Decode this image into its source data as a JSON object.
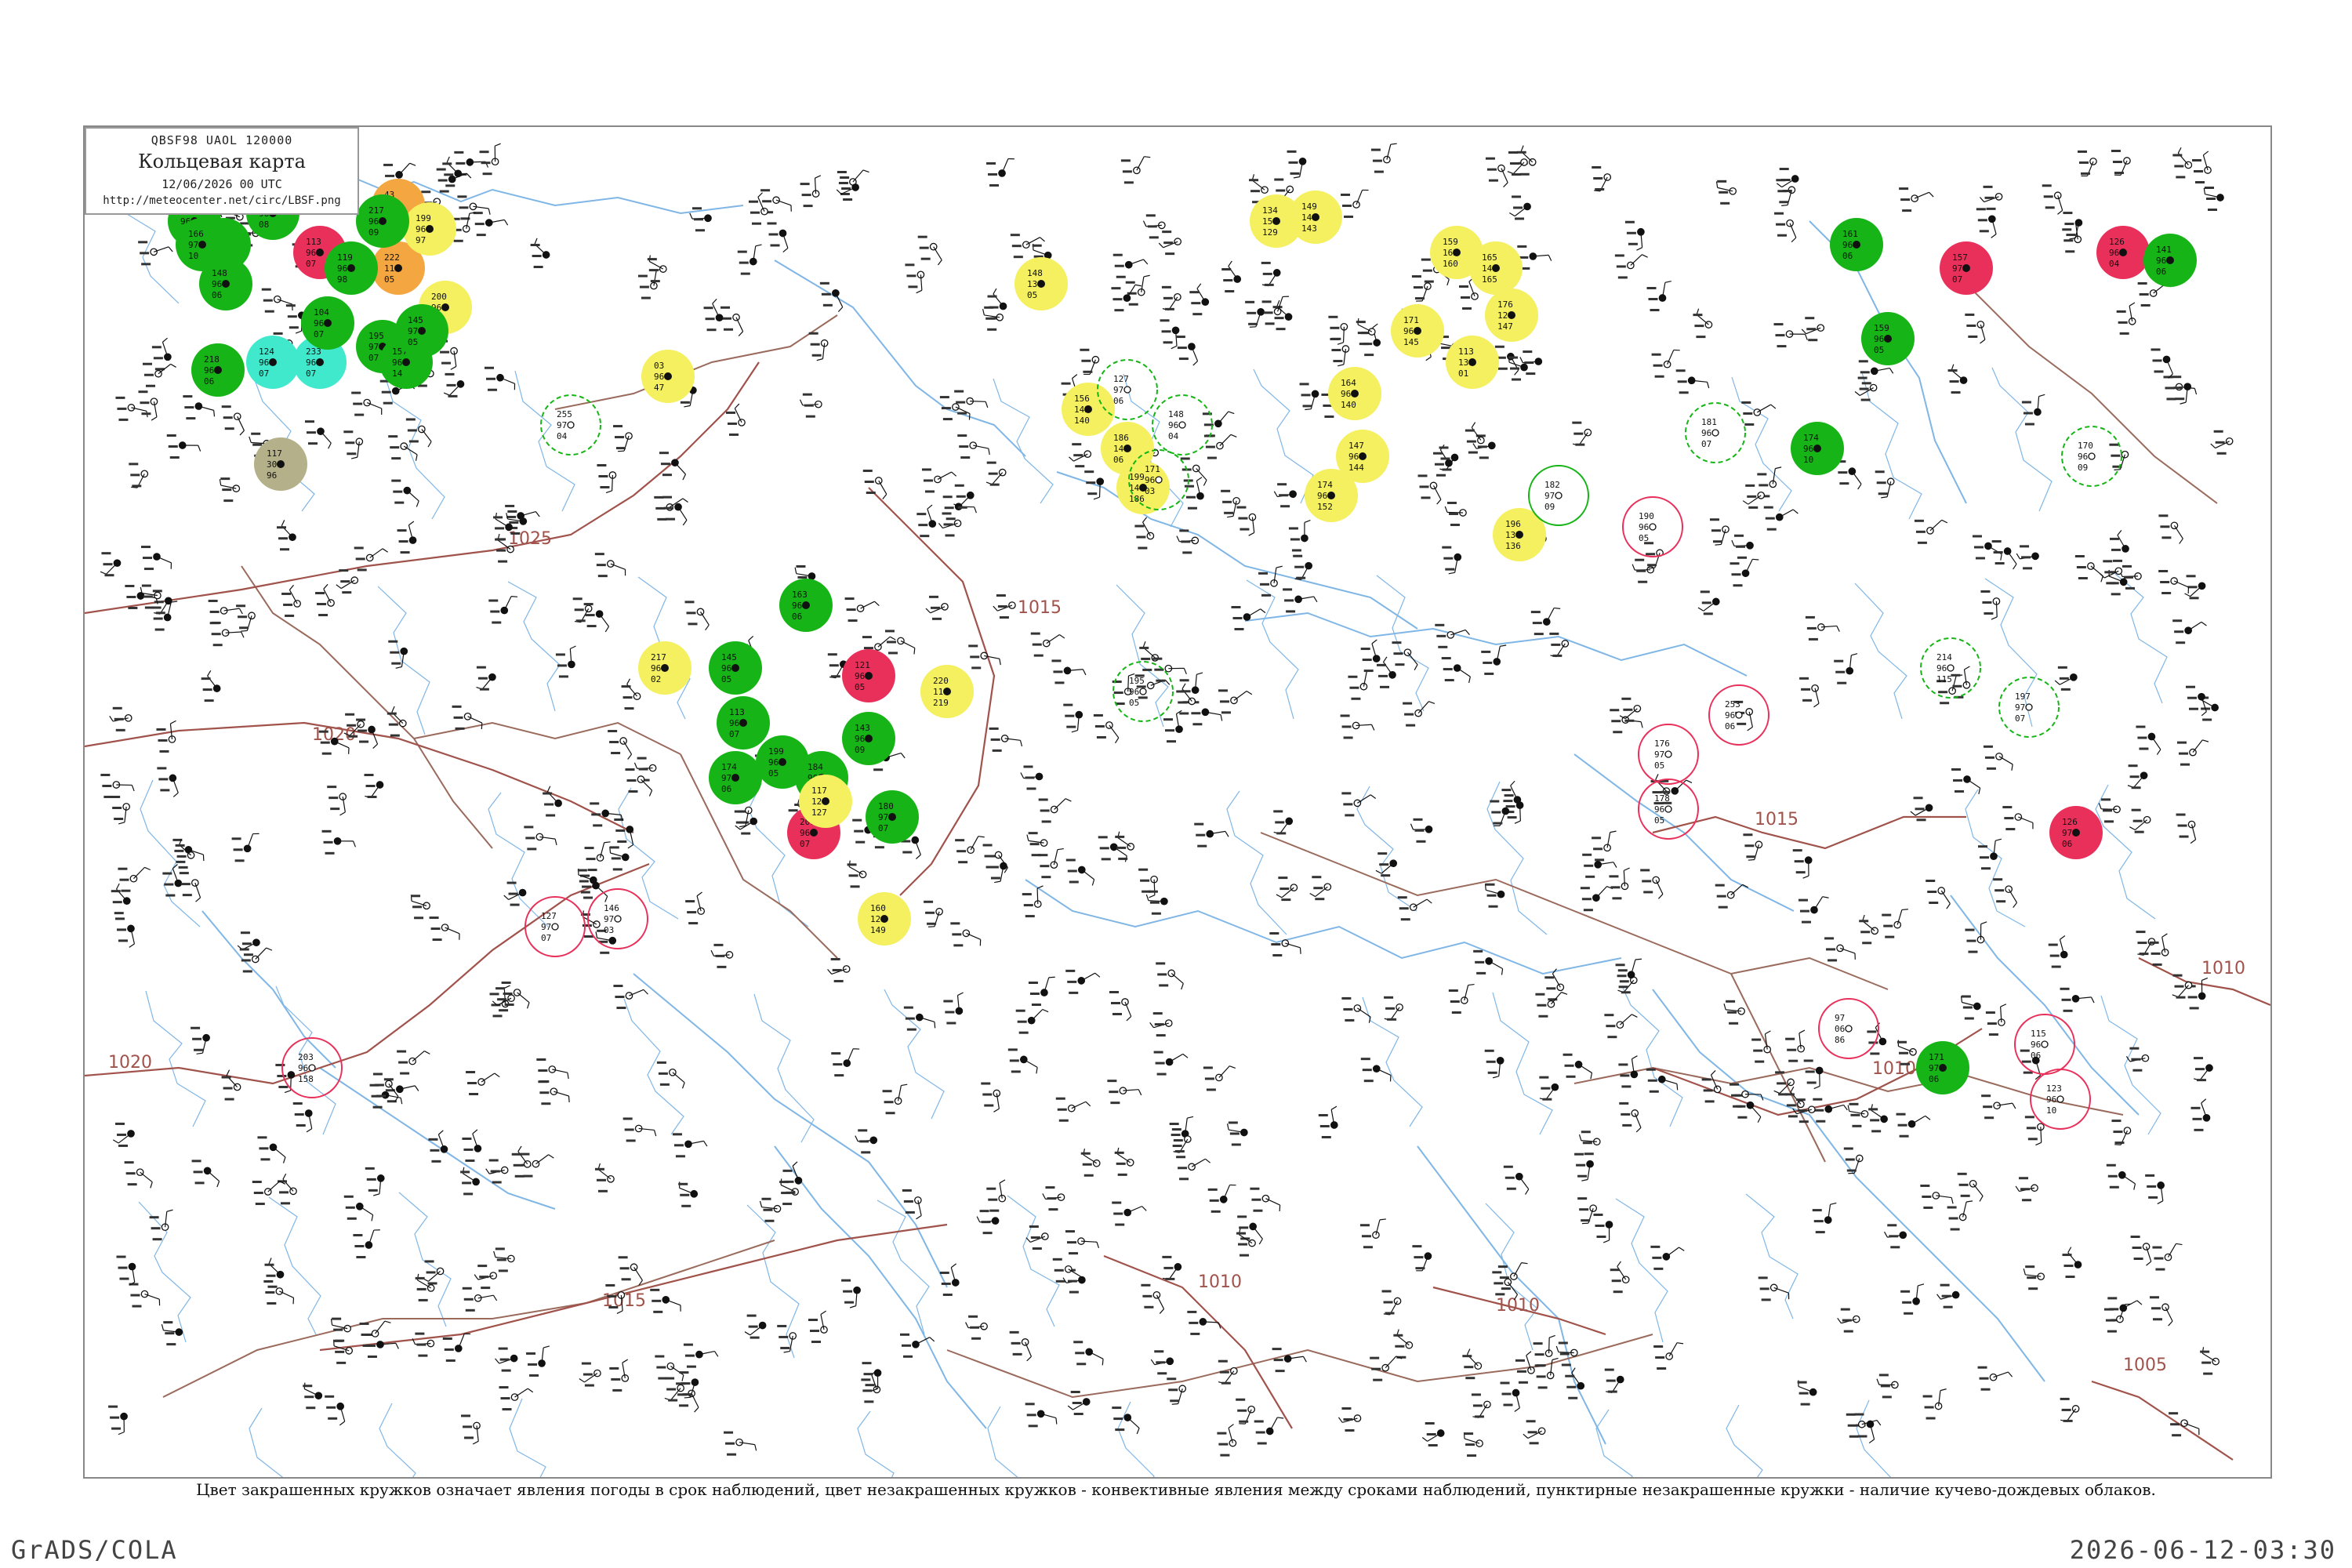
{
  "header": {
    "code_line": "QBSF98  UAOL  120000",
    "title": "Кольцевая карта",
    "date_line": "12/06/2026 00 UTC",
    "url": "http://meteocenter.net/circ/LBSF.png"
  },
  "footer": {
    "caption": "Цвет закрашенных кружков означает явления погоды в срок наблюдений, цвет незакрашенных кружков - конвективные явления между сроками наблюдений, пунктирные незакрашенные кружки - наличие кучево-дождевых облаков.",
    "grads": "GrADS/COLA",
    "timestamp": "2026-06-12-03:30"
  },
  "colors": {
    "coast": "#7fb6e6",
    "border": "#9a6a5c",
    "isobar": "#a0524b",
    "green": "#16b416",
    "red": "#e8305a",
    "yellow": "#f4f060",
    "orange": "#f4a640",
    "cyan": "#40e8cc",
    "olive": "#b4b08a"
  },
  "isobars": [
    {
      "label": "1025"
    },
    {
      "label": "1020"
    },
    {
      "label": "1015"
    },
    {
      "label": "1010"
    },
    {
      "label": "1005"
    }
  ],
  "stations": [
    {
      "kind": "filled",
      "color": "green",
      "top": "121",
      "mid": "96",
      "bot": "07"
    },
    {
      "kind": "filled",
      "color": "green",
      "top": "195",
      "mid": "97",
      "bot": "05"
    },
    {
      "kind": "filled",
      "color": "green",
      "top": "181",
      "mid": "96",
      "bot": "08"
    },
    {
      "kind": "filled",
      "color": "red",
      "top": "113",
      "mid": "96",
      "bot": "07"
    },
    {
      "kind": "filled",
      "color": "orange",
      "top": "43",
      "mid": "12",
      "bot": "05"
    },
    {
      "kind": "filled",
      "color": "orange",
      "top": "222",
      "mid": "11",
      "bot": "05"
    },
    {
      "kind": "filled",
      "color": "cyan",
      "top": "124",
      "mid": "96",
      "bot": "07"
    },
    {
      "kind": "filled",
      "color": "cyan",
      "top": "233",
      "mid": "96",
      "bot": "07"
    },
    {
      "kind": "filled",
      "color": "olive",
      "top": "117",
      "mid": "300",
      "bot": "96"
    },
    {
      "kind": "filled",
      "color": "yellow",
      "top": "200",
      "mid": "96",
      "bot": "04"
    },
    {
      "kind": "filled",
      "color": "yellow",
      "top": "199",
      "mid": "96",
      "bot": "97"
    },
    {
      "kind": "filled",
      "color": "yellow",
      "top": "03",
      "mid": "96",
      "bot": "47"
    },
    {
      "kind": "filled",
      "color": "green",
      "top": "195",
      "mid": "97",
      "bot": "07"
    },
    {
      "kind": "filled",
      "color": "green",
      "top": "157",
      "mid": "96",
      "bot": "14"
    },
    {
      "kind": "filled",
      "color": "green",
      "top": "145",
      "mid": "97",
      "bot": "05"
    },
    {
      "kind": "filled",
      "color": "green",
      "top": "166",
      "mid": "97",
      "bot": "10"
    },
    {
      "kind": "filled",
      "color": "green",
      "top": "119",
      "mid": "96",
      "bot": "98"
    },
    {
      "kind": "filled",
      "color": "green",
      "top": "148",
      "mid": "96",
      "bot": "06"
    },
    {
      "kind": "filled",
      "color": "green",
      "top": "217",
      "mid": "96",
      "bot": "09"
    },
    {
      "kind": "filled",
      "color": "green",
      "top": "218",
      "mid": "96",
      "bot": "06"
    },
    {
      "kind": "filled",
      "color": "green",
      "top": "104",
      "mid": "96",
      "bot": "07"
    },
    {
      "kind": "filled",
      "color": "yellow",
      "top": "217",
      "mid": "96",
      "bot": "02"
    },
    {
      "kind": "filled",
      "color": "green",
      "top": "145",
      "mid": "96",
      "bot": "05"
    },
    {
      "kind": "filled",
      "color": "green",
      "top": "113",
      "mid": "96",
      "bot": "07"
    },
    {
      "kind": "filled",
      "color": "green",
      "top": "199",
      "mid": "96",
      "bot": "05"
    },
    {
      "kind": "filled",
      "color": "green",
      "top": "174",
      "mid": "97",
      "bot": "06"
    },
    {
      "kind": "filled",
      "color": "green",
      "top": "184",
      "mid": "96",
      "bot": "01"
    },
    {
      "kind": "filled",
      "color": "green",
      "top": "163",
      "mid": "96",
      "bot": "06"
    },
    {
      "kind": "filled",
      "color": "red",
      "top": "121",
      "mid": "96",
      "bot": "05"
    },
    {
      "kind": "filled",
      "color": "green",
      "top": "143",
      "mid": "96",
      "bot": "09"
    },
    {
      "kind": "filled",
      "color": "red",
      "top": "207",
      "mid": "96",
      "bot": "07"
    },
    {
      "kind": "filled",
      "color": "green",
      "top": "180",
      "mid": "97",
      "bot": "07"
    },
    {
      "kind": "filled",
      "color": "yellow",
      "top": "160",
      "mid": "129",
      "bot": "149"
    },
    {
      "kind": "filled",
      "color": "yellow",
      "top": "117",
      "mid": "128",
      "bot": "127"
    },
    {
      "kind": "filled",
      "color": "yellow",
      "top": "220",
      "mid": "111",
      "bot": "219"
    },
    {
      "kind": "filled",
      "color": "yellow",
      "top": "148",
      "mid": "134",
      "bot": "05"
    },
    {
      "kind": "filled",
      "color": "yellow",
      "top": "156",
      "mid": "143",
      "bot": "140"
    },
    {
      "kind": "filled",
      "color": "yellow",
      "top": "186",
      "mid": "140",
      "bot": "06"
    },
    {
      "kind": "filled",
      "color": "yellow",
      "top": "199",
      "mid": "140",
      "bot": "186"
    },
    {
      "kind": "filled",
      "color": "yellow",
      "top": "134",
      "mid": "150",
      "bot": "129"
    },
    {
      "kind": "filled",
      "color": "yellow",
      "top": "149",
      "mid": "144",
      "bot": "143"
    },
    {
      "kind": "filled",
      "color": "yellow",
      "top": "164",
      "mid": "96",
      "bot": "140"
    },
    {
      "kind": "filled",
      "color": "yellow",
      "top": "174",
      "mid": "96",
      "bot": "152"
    },
    {
      "kind": "filled",
      "color": "yellow",
      "top": "147",
      "mid": "96",
      "bot": "144"
    },
    {
      "kind": "filled",
      "color": "yellow",
      "top": "171",
      "mid": "96",
      "bot": "145"
    },
    {
      "kind": "filled",
      "color": "yellow",
      "top": "159",
      "mid": "162",
      "bot": "160"
    },
    {
      "kind": "filled",
      "color": "yellow",
      "top": "165",
      "mid": "140",
      "bot": "165"
    },
    {
      "kind": "filled",
      "color": "yellow",
      "top": "113",
      "mid": "139",
      "bot": "01"
    },
    {
      "kind": "filled",
      "color": "yellow",
      "top": "176",
      "mid": "12",
      "bot": "147"
    },
    {
      "kind": "filled",
      "color": "yellow",
      "top": "196",
      "mid": "136",
      "bot": "136"
    },
    {
      "kind": "filled",
      "color": "green",
      "top": "174",
      "mid": "96",
      "bot": "10"
    },
    {
      "kind": "filled",
      "color": "green",
      "top": "161",
      "mid": "96",
      "bot": "06"
    },
    {
      "kind": "filled",
      "color": "green",
      "top": "159",
      "mid": "96",
      "bot": "05"
    },
    {
      "kind": "filled",
      "color": "red",
      "top": "157",
      "mid": "97",
      "bot": "07"
    },
    {
      "kind": "filled",
      "color": "red",
      "top": "126",
      "mid": "96",
      "bot": "04"
    },
    {
      "kind": "filled",
      "color": "green",
      "top": "141",
      "mid": "96",
      "bot": "06"
    },
    {
      "kind": "filled",
      "color": "red",
      "top": "126",
      "mid": "97",
      "bot": "06"
    },
    {
      "kind": "filled",
      "color": "green",
      "top": "171",
      "mid": "97",
      "bot": "06"
    }
  ],
  "rings": [
    {
      "style": "dashed",
      "color": "green",
      "top": "255",
      "mid": "97",
      "bot": "04"
    },
    {
      "style": "dashed",
      "color": "green",
      "top": "127",
      "mid": "97",
      "bot": "06"
    },
    {
      "style": "dashed",
      "color": "green",
      "top": "148",
      "mid": "96",
      "bot": "04"
    },
    {
      "style": "dashed",
      "color": "green",
      "top": "171",
      "mid": "96",
      "bot": "03"
    },
    {
      "style": "dashed",
      "color": "green",
      "top": "195",
      "mid": "96",
      "bot": "05"
    },
    {
      "style": "dashed",
      "color": "green",
      "top": "214",
      "mid": "96",
      "bot": "115"
    },
    {
      "style": "dashed",
      "color": "green",
      "top": "181",
      "mid": "96",
      "bot": "07"
    },
    {
      "style": "dashed",
      "color": "green",
      "top": "197",
      "mid": "97",
      "bot": "07"
    },
    {
      "style": "dashed",
      "color": "green",
      "top": "170",
      "mid": "96",
      "bot": "09"
    },
    {
      "style": "solid",
      "color": "green",
      "top": "182",
      "mid": "97",
      "bot": "09"
    },
    {
      "style": "solid",
      "color": "red",
      "top": "190",
      "mid": "96",
      "bot": "05"
    },
    {
      "style": "solid",
      "color": "red",
      "top": "253",
      "mid": "96",
      "bot": "06"
    },
    {
      "style": "solid",
      "color": "red",
      "top": "178",
      "mid": "96",
      "bot": "05"
    },
    {
      "style": "solid",
      "color": "red",
      "top": "176",
      "mid": "97",
      "bot": "05"
    },
    {
      "style": "solid",
      "color": "red",
      "top": "97",
      "mid": "06",
      "bot": "86"
    },
    {
      "style": "solid",
      "color": "red",
      "top": "115",
      "mid": "96",
      "bot": "06"
    },
    {
      "style": "solid",
      "color": "red",
      "top": "123",
      "mid": "96",
      "bot": "10"
    },
    {
      "style": "solid",
      "color": "red",
      "top": "203",
      "mid": "96",
      "bot": "158"
    },
    {
      "style": "solid",
      "color": "red",
      "top": "146",
      "mid": "97",
      "bot": "03"
    },
    {
      "style": "solid",
      "color": "red",
      "top": "127",
      "mid": "97",
      "bot": "07"
    }
  ]
}
